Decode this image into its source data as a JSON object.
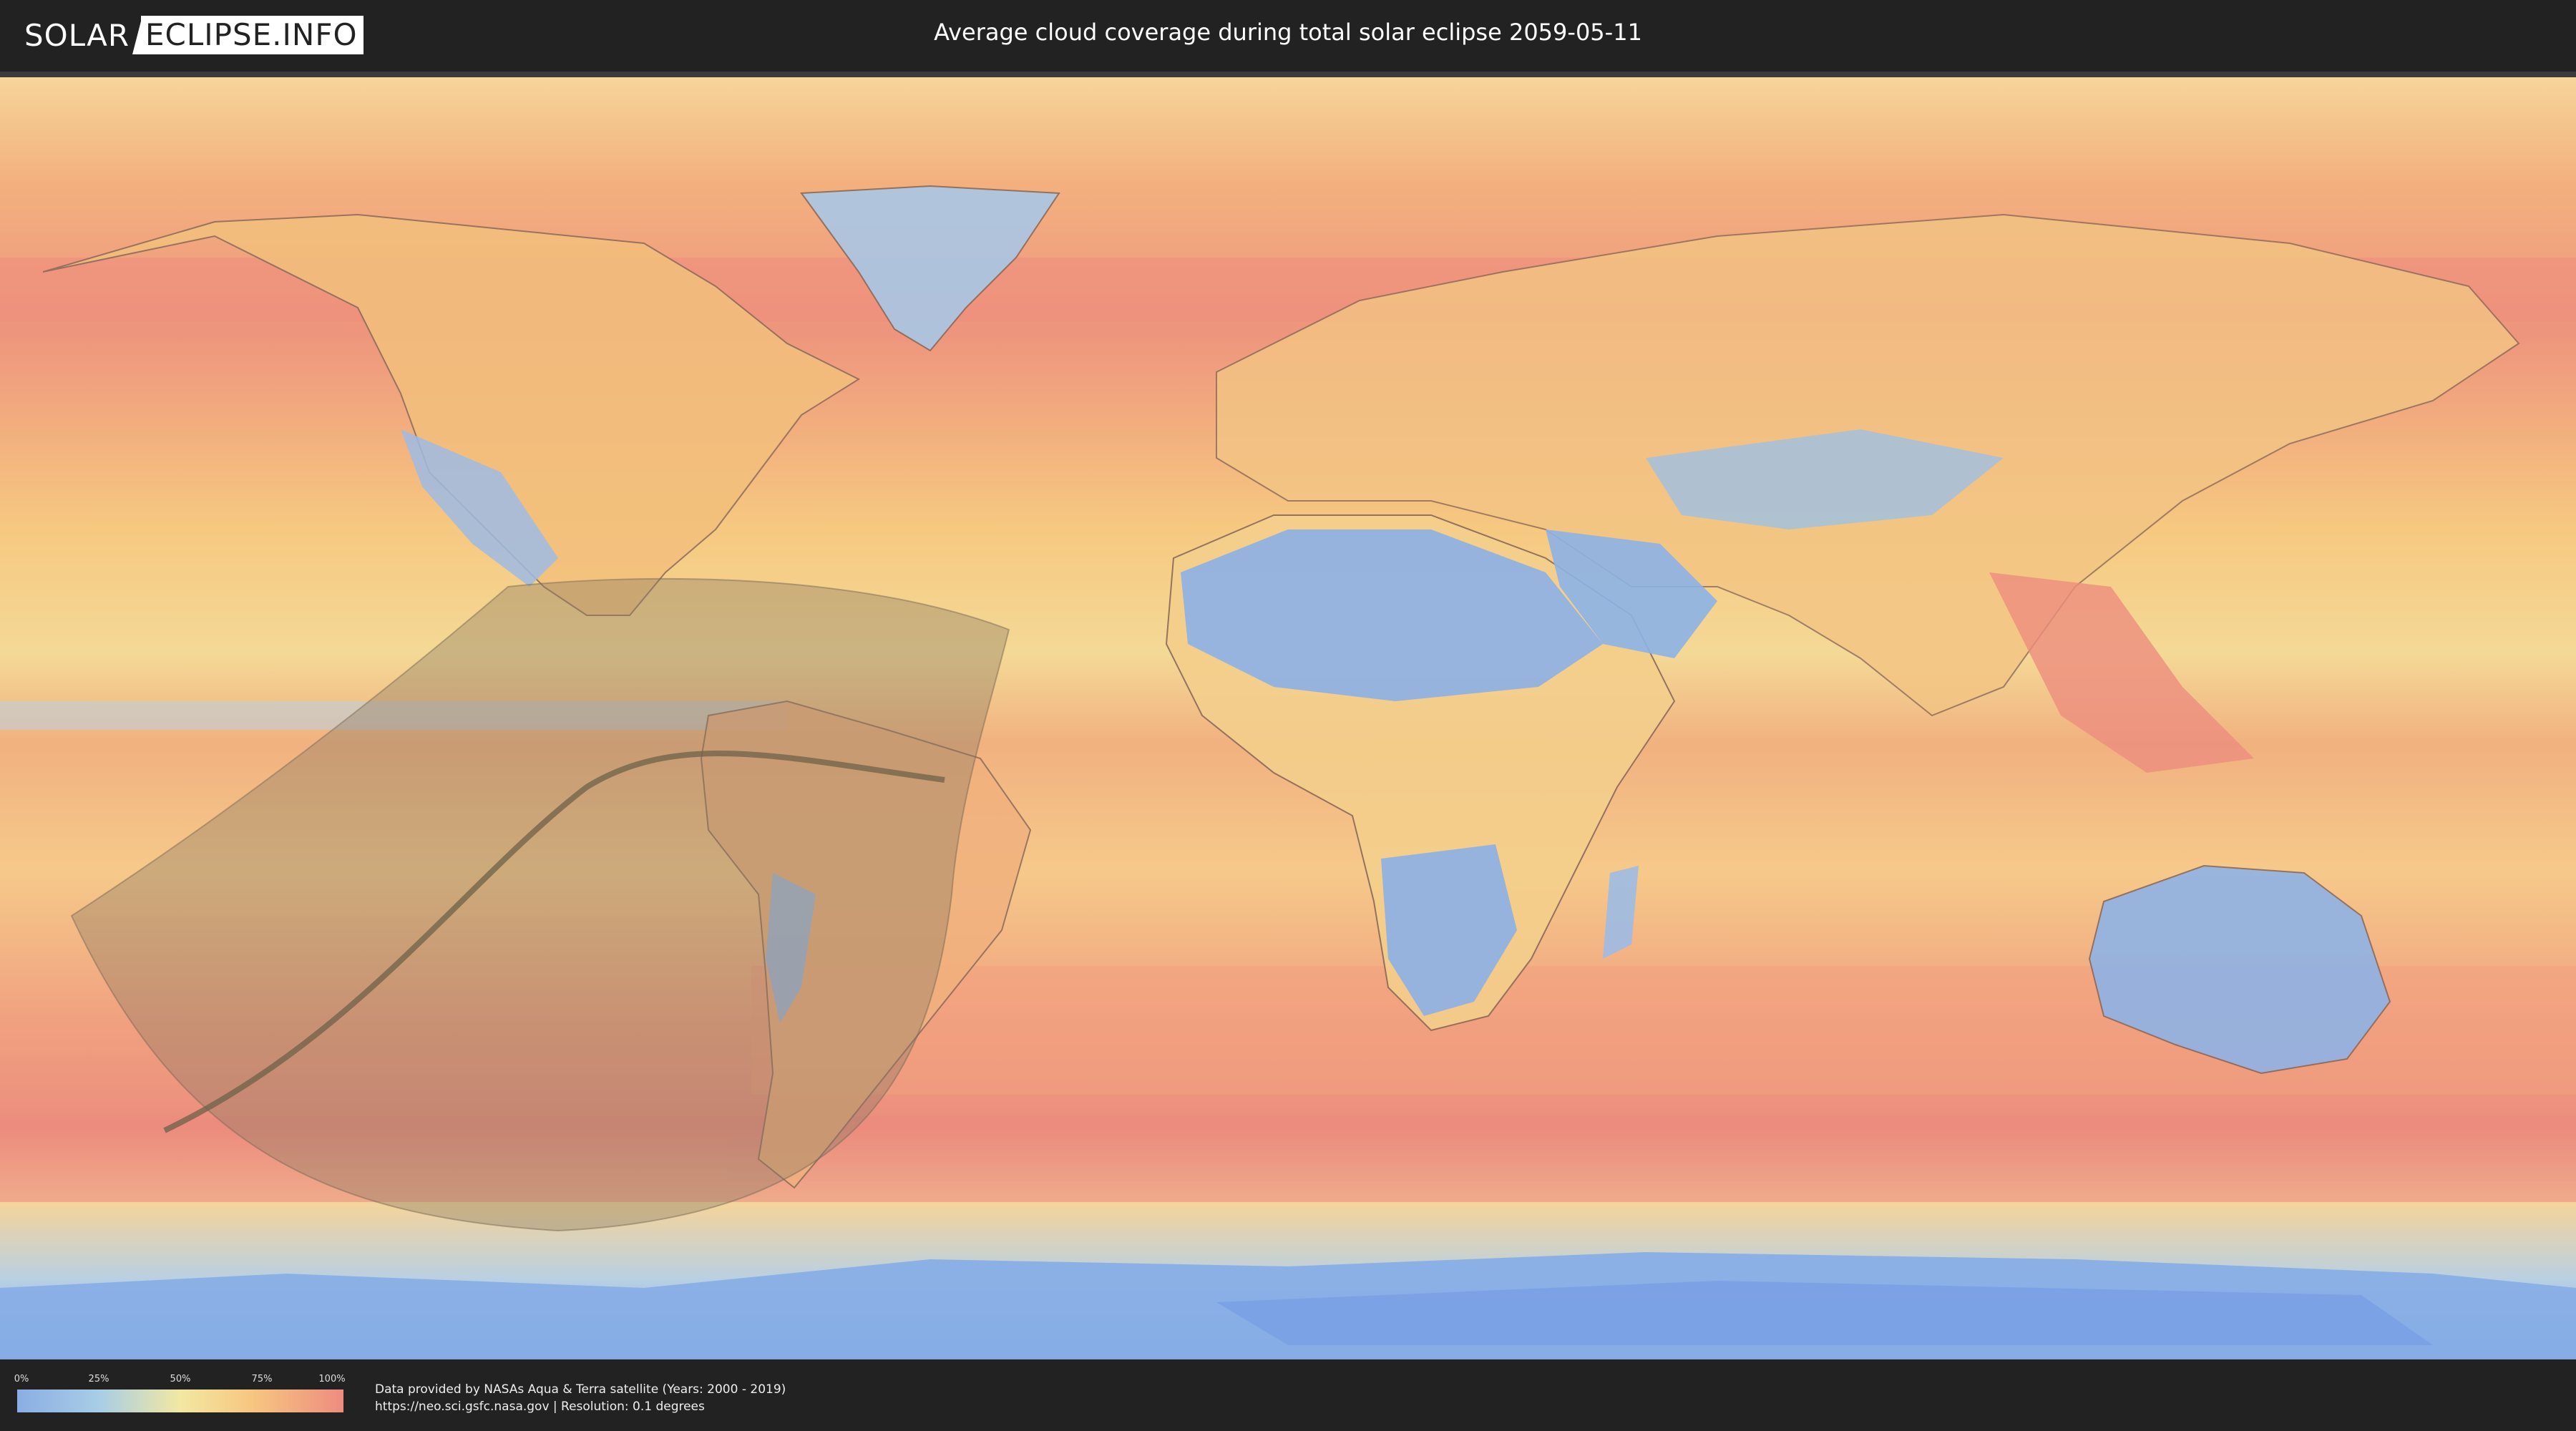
{
  "header": {
    "logo_left": "SOLAR",
    "logo_right": "ECLIPSE.INFO",
    "title": "Average cloud coverage during total solar eclipse 2059-05-11"
  },
  "legend": {
    "ticks": [
      "0%",
      "25%",
      "50%",
      "75%",
      "100%"
    ],
    "colors": [
      "#8aaee3",
      "#a8cde6",
      "#f2e8a2",
      "#f7c680",
      "#ee8c7f"
    ]
  },
  "footer": {
    "credit_line1": "Data provided by NASAs Aqua & Terra satellite (Years: 2000 - 2019)",
    "credit_line2": "https://neo.sci.gsfc.nasa.gov | Resolution: 0.1 degrees"
  },
  "map": {
    "projection": "equirectangular",
    "ocean_color": "#f4c27c",
    "low_cloud_color": "#8db2e6",
    "high_cloud_color": "#ec8a7d",
    "eclipse_shadow_color": "#8a7a62"
  }
}
